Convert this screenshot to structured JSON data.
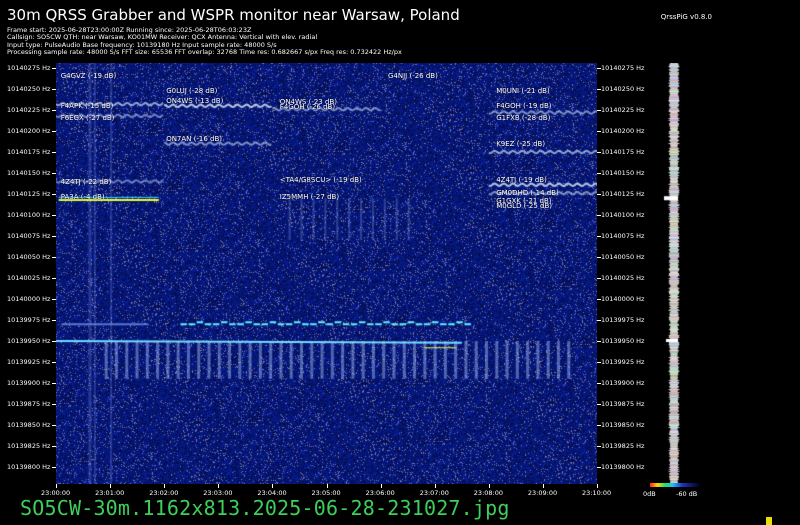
{
  "header": {
    "title": "30m QRSS Grabber and WSPR monitor near Warsaw, Poland",
    "version": "QrssPiG v0.8.0",
    "info_lines": [
      "Frame start: 2025-06-28T23:00:00Z Running since: 2025-06-28T06:03:23Z",
      "Callsign: SO5CW QTH: near Warsaw, KO01MW Receiver: QCX Antenna: Vertical with elev. radial",
      "Input type: PulseAudio Base frequency: 10139180 Hz Input sample rate: 48000 S/s",
      "Processing sample rate: 48000 S/s FFT size: 65536 FFT overlap: 32768 Time res: 0.682667 s/px Freq res: 0.732422 Hz/px"
    ]
  },
  "waterfall": {
    "freq_labels": [
      "10140275 Hz",
      "10140250 Hz",
      "10140225 Hz",
      "10140200 Hz",
      "10140175 Hz",
      "10140150 Hz",
      "10140125 Hz",
      "10140100 Hz",
      "10140075 Hz",
      "10140050 Hz",
      "10140025 Hz",
      "10140000 Hz",
      "10139975 Hz",
      "10139950 Hz",
      "10139925 Hz",
      "10139900 Hz",
      "10139875 Hz",
      "10139850 Hz",
      "10139825 Hz",
      "10139800 Hz"
    ],
    "freq_values": [
      10140275,
      10140250,
      10140225,
      10140200,
      10140175,
      10140150,
      10140125,
      10140100,
      10140075,
      10140050,
      10140025,
      10140000,
      10139975,
      10139950,
      10139925,
      10139900,
      10139875,
      10139850,
      10139825,
      10139800
    ],
    "time_labels": [
      "23:00:00",
      "23:01:00",
      "23:02:00",
      "23:03:00",
      "23:04:00",
      "23:05:00",
      "23:06:00",
      "23:07:00",
      "23:08:00",
      "23:09:00",
      "23:10:00"
    ],
    "spots": [
      {
        "label": "G4GVZ (-19 dB)",
        "minute": 0.05,
        "freq": 10140264
      },
      {
        "label": "G0LUJ (-28 dB)",
        "minute": 2.0,
        "freq": 10140247
      },
      {
        "label": "ON4WS (-13 dB)",
        "minute": 2.0,
        "freq": 10140234
      },
      {
        "label": "F4APK (-15 dB)",
        "minute": 0.05,
        "freq": 10140228
      },
      {
        "label": "F6EGX (-27 dB)",
        "minute": 0.05,
        "freq": 10140214
      },
      {
        "label": "ON4WS (-23 dB)",
        "minute": 4.1,
        "freq": 10140233
      },
      {
        "label": "F4GOH (-26 dB)",
        "minute": 4.1,
        "freq": 10140227
      },
      {
        "label": "G4NJJ (-26 dB)",
        "minute": 6.1,
        "freq": 10140264
      },
      {
        "label": "M0UNI (-21 dB)",
        "minute": 8.1,
        "freq": 10140246
      },
      {
        "label": "F4GOH (-19 dB)",
        "minute": 8.1,
        "freq": 10140228
      },
      {
        "label": "G1FXB (-28 dB)",
        "minute": 8.1,
        "freq": 10140214
      },
      {
        "label": "ON7AN (-16 dB)",
        "minute": 2.0,
        "freq": 10140189
      },
      {
        "label": "K9EZ (-25 dB)",
        "minute": 8.1,
        "freq": 10140183
      },
      {
        "label": "4Z4TJ (-22 dB)",
        "minute": 0.05,
        "freq": 10140138
      },
      {
        "label": "<TA4/G8SCU> (-19 dB)",
        "minute": 4.1,
        "freq": 10140141
      },
      {
        "label": "4Z4TJ (-19 dB)",
        "minute": 8.1,
        "freq": 10140140
      },
      {
        "label": "IZ5MMH (-27 dB)",
        "minute": 4.1,
        "freq": 10140120
      },
      {
        "label": "GM0DHD (-14 dB)",
        "minute": 8.1,
        "freq": 10140125
      },
      {
        "label": "G1GXK (-21 dB)",
        "minute": 8.1,
        "freq": 10140116
      },
      {
        "label": "M0GLD (-25 dB)",
        "minute": 8.1,
        "freq": 10140110
      },
      {
        "label": "PA3A (-4 dB)",
        "minute": 0.05,
        "freq": 10140120
      }
    ]
  },
  "profile": {
    "legend_left": "0dB",
    "legend_right": "-60 dB"
  },
  "footer": {
    "filename": "SO5CW-30m.1162x813.2025-06-28-231027.jpg"
  }
}
